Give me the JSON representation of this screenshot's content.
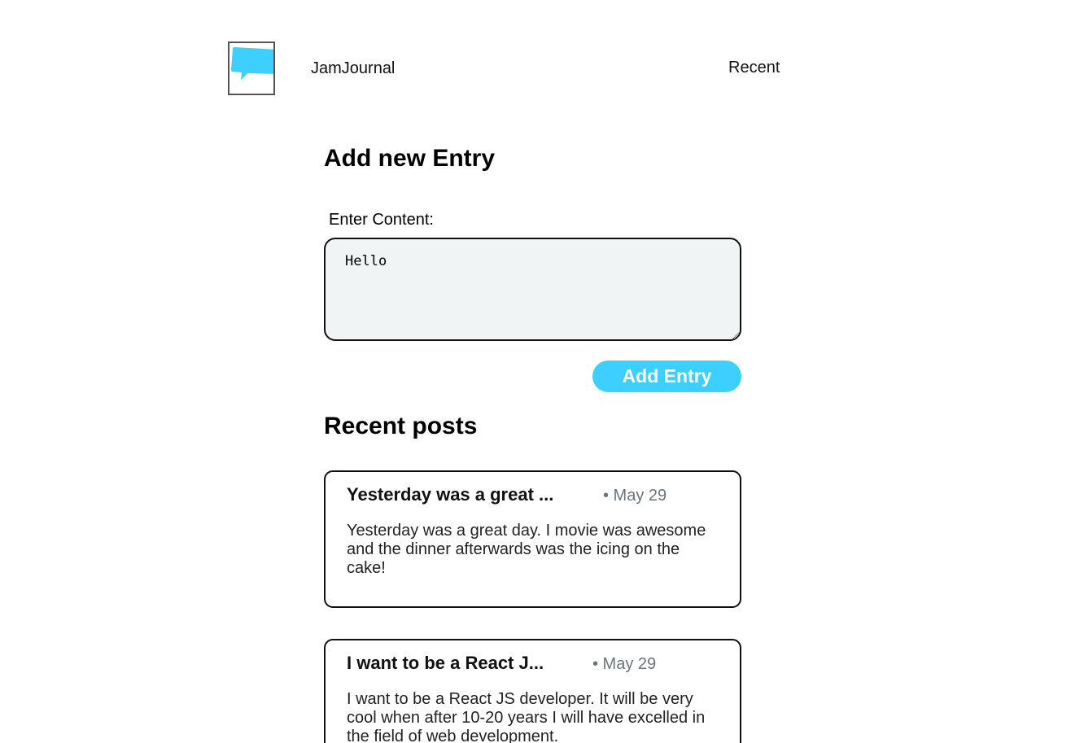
{
  "header": {
    "brand": "JamJournal",
    "logo_icon": "chat-bubble-icon",
    "nav_recent": "Recent"
  },
  "form": {
    "title": "Add new Entry",
    "content_label": "Enter Content:",
    "content_value": "Hello",
    "submit_label": "Add Entry"
  },
  "posts_section": {
    "title": "Recent posts",
    "posts": [
      {
        "title": "Yesterday was a great ...",
        "date": "• May 29",
        "body": "Yesterday was a great day. I movie was awesome and the dinner afterwards was the icing on the cake!"
      },
      {
        "title": "I want to be a React J...",
        "date": "• May 29",
        "body": "I want to be a React JS developer. It will be very cool when after 10-20 years I will have excelled in the field of web development."
      }
    ]
  },
  "colors": {
    "accent": "#3ccfff",
    "date_text": "#6b747b",
    "input_bg": "#f1f4f4"
  }
}
